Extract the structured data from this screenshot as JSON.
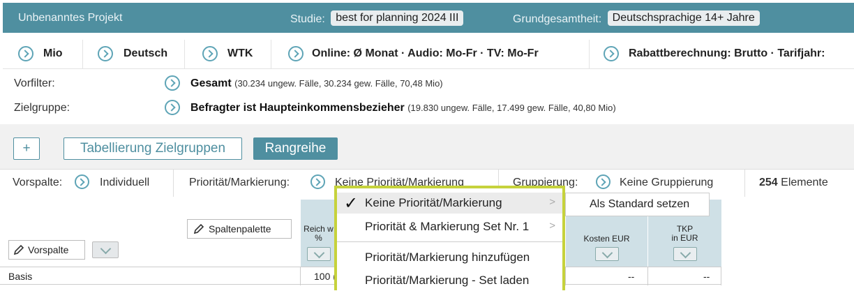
{
  "topbar": {
    "project": "Unbenanntes Projekt",
    "studie_label": "Studie:",
    "studie_value": "best for planning 2024 III",
    "grund_label": "Grundgesamtheit:",
    "grund_value": "Deutschsprachige 14+ Jahre"
  },
  "chips": [
    "Mio",
    "Deutsch",
    "WTK",
    "Online: Ø Monat · Audio: Mo-Fr · TV: Mo-Fr",
    "Rabattberechnung: Brutto · Tarifjahr:"
  ],
  "filters": {
    "vorfilter_label": "Vorfilter:",
    "vorfilter_value": "Gesamt",
    "vorfilter_detail": "(30.234 ungew. Fälle, 30.234 gew. Fälle, 70,48 Mio)",
    "zielgruppe_label": "Zielgruppe:",
    "zielgruppe_value": "Befragter ist Haupteinkommensbezieher",
    "zielgruppe_detail": "(19.830 ungew. Fälle, 17.499 gew. Fälle, 40,80 Mio)"
  },
  "toolbar": {
    "add_label": "+",
    "tab_label": "Tabellierung Zielgruppen",
    "rang_label": "Rangreihe"
  },
  "controls": {
    "vorspalte_label": "Vorspalte:",
    "vorspalte_value": "Individuell",
    "prio_label": "Priorität/Markierung:",
    "prio_value": "Keine Priorität/Markierung",
    "grupp_label": "Gruppierung:",
    "grupp_value": "Keine Gruppierung",
    "count": "254",
    "count_label": "Elemente"
  },
  "table": {
    "spaltenpalette": "Spaltenpalette",
    "vorspalte_btn": "Vorspalte",
    "col1": "Reich w",
    "col1_unit": "%",
    "col_kosten": "Kosten EUR",
    "col_tkp": "TKP",
    "col_tkp_unit": "in EUR",
    "row_basis": "Basis",
    "row_basis_val": "100 (",
    "row_kosten": "--",
    "row_tkp": "--"
  },
  "menu": {
    "items": [
      "Keine Priorität/Markierung",
      "Priorität & Markierung Set Nr. 1",
      "Priorität/Markierung hinzufügen",
      "Priorität/Markierung - Set laden"
    ],
    "submenu": "Als Standard setzen",
    "check_glyph": "✓",
    "arrow_glyph": ">"
  },
  "colors": {
    "accent": "#4f8fa0",
    "highlight": "#c6d23c"
  }
}
